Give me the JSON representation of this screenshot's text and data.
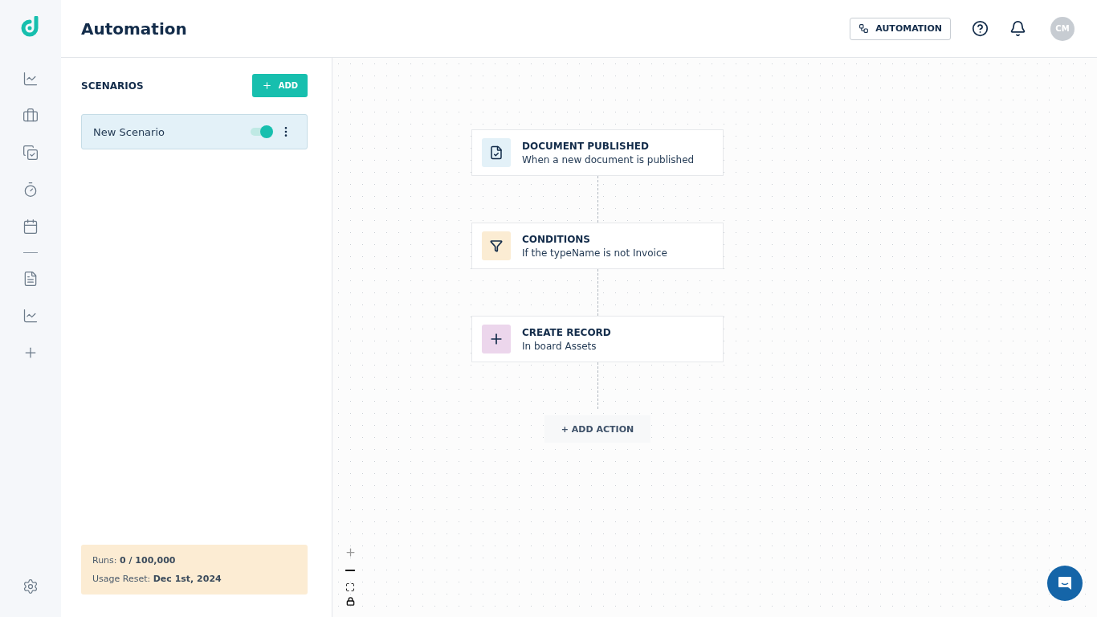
{
  "header": {
    "title": "Automation",
    "automation_button": "AUTOMATION",
    "avatar": "CM"
  },
  "scenarios": {
    "title": "SCENARIOS",
    "add_button": "ADD",
    "items": [
      {
        "name": "New Scenario",
        "selected": true,
        "on": true
      }
    ]
  },
  "usage": {
    "lines": [
      "Runs: **0 / 100,000**",
      "Usage Reset: **Dec 1st, 2024**"
    ]
  },
  "flow": {
    "nodes": [
      {
        "kind": "document",
        "color": "#e3f1f8",
        "title": "DOCUMENT PUBLISHED",
        "subtitle": "When a new document is published"
      },
      {
        "kind": "filter",
        "color": "#fbecd3",
        "title": "CONDITIONS",
        "subtitle": "If the typeName is not Invoice"
      },
      {
        "kind": "plus",
        "color": "#ecd6ec",
        "title": "CREATE RECORD",
        "subtitle": "In board Assets"
      }
    ],
    "add_action": "+ ADD ACTION"
  }
}
